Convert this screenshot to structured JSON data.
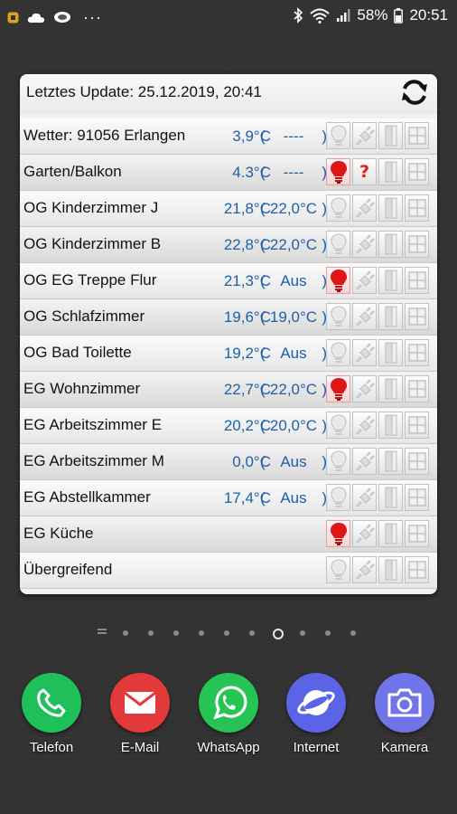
{
  "statusbar": {
    "battery": "58%",
    "time": "20:51",
    "more": "···"
  },
  "widget": {
    "title": "Letztes Update: 25.12.2019, 20:41"
  },
  "rooms": [
    {
      "name": "Wetter: 91056 Erlangen",
      "temp": "3,9°C",
      "set": "----",
      "bulb_on": false,
      "unknown": false
    },
    {
      "name": "Garten/Balkon",
      "temp": "4.3°C",
      "set": "----",
      "bulb_on": true,
      "unknown": true
    },
    {
      "name": "OG Kinderzimmer J",
      "temp": "21,8°C",
      "set": "22,0°C",
      "bulb_on": false,
      "unknown": false
    },
    {
      "name": "OG Kinderzimmer B",
      "temp": "22,8°C",
      "set": "22,0°C",
      "bulb_on": false,
      "unknown": false
    },
    {
      "name": "OG EG Treppe Flur",
      "temp": "21,3°C",
      "set": "Aus",
      "bulb_on": true,
      "unknown": false
    },
    {
      "name": "OG Schlafzimmer",
      "temp": "19,6°C",
      "set": "19,0°C",
      "bulb_on": false,
      "unknown": false
    },
    {
      "name": "OG Bad Toilette",
      "temp": "19,2°C",
      "set": "Aus",
      "bulb_on": false,
      "unknown": false
    },
    {
      "name": "EG Wohnzimmer",
      "temp": "22,7°C",
      "set": "22,0°C",
      "bulb_on": true,
      "unknown": false
    },
    {
      "name": "EG Arbeitszimmer E",
      "temp": "20,2°C",
      "set": "20,0°C",
      "bulb_on": false,
      "unknown": false
    },
    {
      "name": "EG Arbeitszimmer M",
      "temp": "0,0°C",
      "set": "Aus",
      "bulb_on": false,
      "unknown": false
    },
    {
      "name": "EG Abstellkammer",
      "temp": "17,4°C",
      "set": "Aus",
      "bulb_on": false,
      "unknown": false
    },
    {
      "name": "EG Küche",
      "temp": "",
      "set": "",
      "bulb_on": true,
      "unknown": false
    },
    {
      "name": "Übergreifend",
      "temp": "",
      "set": "",
      "bulb_on": false,
      "unknown": false
    }
  ],
  "pager": {
    "count": 11,
    "current": 7
  },
  "dock": [
    {
      "label": "Telefon",
      "icon": "phone-icon",
      "color": "#1fc05a"
    },
    {
      "label": "E-Mail",
      "icon": "mail-icon",
      "color": "#e23a3a"
    },
    {
      "label": "WhatsApp",
      "icon": "whatsapp-icon",
      "color": "#25c455"
    },
    {
      "label": "Internet",
      "icon": "internet-icon",
      "color": "#5b63e6"
    },
    {
      "label": "Kamera",
      "icon": "camera-icon",
      "color": "#6f74e8"
    }
  ],
  "colors": {
    "accent_blue": "#1f5fa8",
    "bulb_red": "#e01515"
  }
}
